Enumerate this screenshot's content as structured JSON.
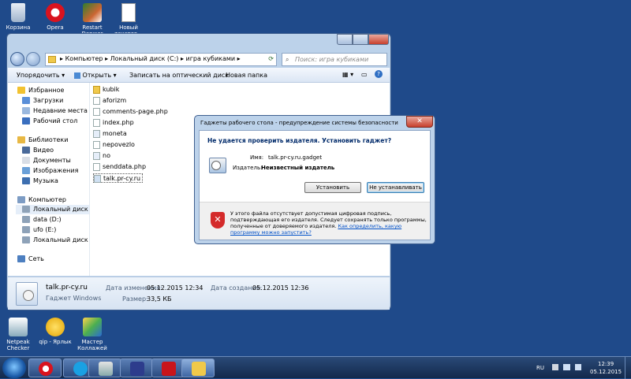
{
  "desktop": {
    "icons_top": [
      {
        "label": "Корзина"
      },
      {
        "label": "Opera"
      },
      {
        "label": "Restart Denwer"
      },
      {
        "label": "Новый текстов..."
      }
    ],
    "icons_bottom": [
      {
        "label": "Netpeak Checker"
      },
      {
        "label": "qip - Ярлык"
      },
      {
        "label": "Мастер Коллажей"
      }
    ]
  },
  "explorer": {
    "breadcrumb": [
      "Компьютер",
      "Локальный диск (C:)",
      "игра кубиками"
    ],
    "search_placeholder": "Поиск: игра кубиками",
    "toolbar": {
      "organize": "Упорядочить",
      "open": "Открыть",
      "burn": "Записать на оптический диск",
      "new_folder": "Новая папка"
    },
    "nav": {
      "favorites": "Избранное",
      "downloads": "Загрузки",
      "recent": "Недавние места",
      "desktop": "Рабочий стол",
      "libraries": "Библиотеки",
      "video": "Видео",
      "documents": "Документы",
      "images": "Изображения",
      "music": "Музыка",
      "computer": "Компьютер",
      "drive_c": "Локальный диск (C",
      "drive_d": "data (D:)",
      "drive_e": "ufo (E:)",
      "drive_z": "Локальный диск (Z",
      "network": "Сеть"
    },
    "files": [
      {
        "name": "kubik",
        "type": "folder"
      },
      {
        "name": "aforizm",
        "type": "file"
      },
      {
        "name": "comments-page.php",
        "type": "file"
      },
      {
        "name": "index.php",
        "type": "file"
      },
      {
        "name": "moneta",
        "type": "file"
      },
      {
        "name": "nepovezlo",
        "type": "file"
      },
      {
        "name": "no",
        "type": "file"
      },
      {
        "name": "senddata.php",
        "type": "file"
      },
      {
        "name": "talk.pr-cy.ru",
        "type": "gadget"
      }
    ],
    "details": {
      "name": "talk.pr-cy.ru",
      "type": "Гаджет Windows",
      "modified_label": "Дата изменения:",
      "modified_value": "05.12.2015 12:34",
      "created_label": "Дата создания:",
      "created_value": "05.12.2015 12:36",
      "size_label": "Размер:",
      "size_value": "33,5 КБ"
    }
  },
  "dialog": {
    "title": "Гаджеты рабочего стола - предупреждение системы безопасности",
    "heading": "Не удается проверить издателя. Установить гаджет?",
    "name_label": "Имя:",
    "name_value": "talk.pr-cy.ru.gadget",
    "publisher_label": "Издатель:",
    "publisher_value": "Неизвестный издатель",
    "install_btn": "Установить",
    "dont_install_btn": "Не устанавливать",
    "warning_text": "У этого файла отсутствует допустимая цифровая подпись, подтверждающая его издателя.  Следует сохранять только программы, полученные от доверяемого издателя.",
    "link_text": "Как определить, какую программу можно запустить?",
    "close_symbol": "✕"
  },
  "taskbar": {
    "lang": "RU",
    "time": "12:39",
    "date": "05.12.2015"
  },
  "colors": {
    "desktop": "#1f4a8a",
    "window_frame": "#bcd2ea",
    "close_red": "#c7402d",
    "link": "#0050c8"
  }
}
